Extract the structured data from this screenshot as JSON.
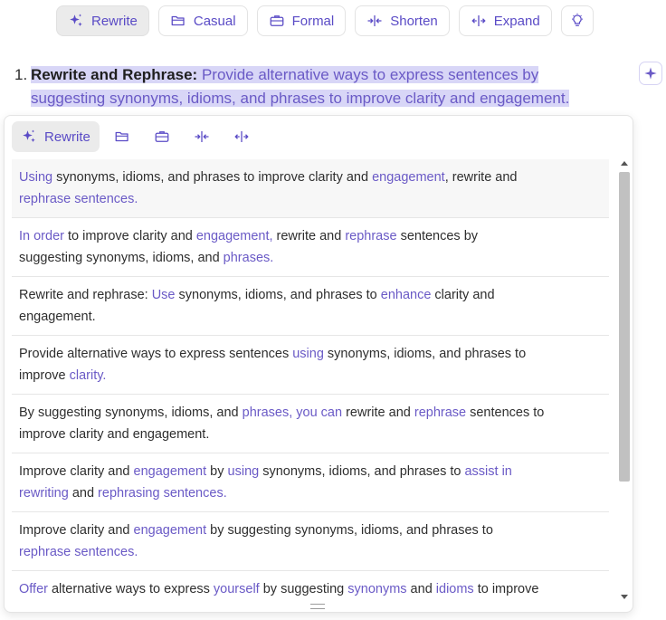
{
  "toolbar": {
    "buttons": [
      {
        "label": "Rewrite",
        "icon": "sparkle-icon",
        "active": true
      },
      {
        "label": "Casual",
        "icon": "folder-icon"
      },
      {
        "label": "Formal",
        "icon": "briefcase-icon"
      },
      {
        "label": "Shorten",
        "icon": "shorten-icon"
      },
      {
        "label": "Expand",
        "icon": "expand-icon"
      }
    ],
    "extra_icon": "lightbulb-icon"
  },
  "editor": {
    "list_number": "1.",
    "bold_text": "Rewrite and Rephrase:",
    "text_line1": " Provide alternative ways to express sentences by",
    "text_line2": "suggesting synonyms, idioms, and phrases to improve clarity and engagement."
  },
  "panel": {
    "active_label": "Rewrite",
    "suggestions": [
      [
        {
          "t": "Using",
          "h": true
        },
        {
          "t": " synonyms, idioms, and phrases to improve clarity and "
        },
        {
          "t": "engagement",
          "h": true
        },
        {
          "t": ", rewrite and "
        },
        {
          "br": true
        },
        {
          "t": "rephrase sentences.",
          "h": true
        }
      ],
      [
        {
          "t": "In order",
          "h": true
        },
        {
          "t": " to improve clarity and "
        },
        {
          "t": "engagement,",
          "h": true
        },
        {
          "t": " rewrite and "
        },
        {
          "t": "rephrase",
          "h": true
        },
        {
          "t": " sentences by "
        },
        {
          "br": true
        },
        {
          "t": "suggesting synonyms, idioms, and "
        },
        {
          "t": "phrases.",
          "h": true
        }
      ],
      [
        {
          "t": "Rewrite and rephrase: "
        },
        {
          "t": "Use",
          "h": true
        },
        {
          "t": " synonyms, idioms, and phrases to "
        },
        {
          "t": "enhance",
          "h": true
        },
        {
          "t": " clarity and "
        },
        {
          "br": true
        },
        {
          "t": "engagement."
        }
      ],
      [
        {
          "t": "Provide alternative ways to express sentences "
        },
        {
          "t": "using",
          "h": true
        },
        {
          "t": " synonyms, idioms, and phrases to "
        },
        {
          "br": true
        },
        {
          "t": "improve "
        },
        {
          "t": "clarity.",
          "h": true
        }
      ],
      [
        {
          "t": "By suggesting synonyms, idioms, and "
        },
        {
          "t": "phrases, you can",
          "h": true
        },
        {
          "t": " rewrite and "
        },
        {
          "t": "rephrase",
          "h": true
        },
        {
          "t": " sentences to "
        },
        {
          "br": true
        },
        {
          "t": "improve clarity and engagement."
        }
      ],
      [
        {
          "t": "Improve clarity and "
        },
        {
          "t": "engagement",
          "h": true
        },
        {
          "t": " by "
        },
        {
          "t": "using",
          "h": true
        },
        {
          "t": " synonyms, idioms, and phrases to "
        },
        {
          "t": "assist in",
          "h": true
        },
        {
          "br": true
        },
        {
          "t": "rewriting",
          "h": true
        },
        {
          "t": " and "
        },
        {
          "t": "rephrasing sentences.",
          "h": true
        }
      ],
      [
        {
          "t": "Improve clarity and "
        },
        {
          "t": "engagement",
          "h": true
        },
        {
          "t": " by suggesting synonyms, idioms, and phrases to "
        },
        {
          "br": true
        },
        {
          "t": "rephrase sentences.",
          "h": true
        }
      ],
      [
        {
          "t": "Offer",
          "h": true
        },
        {
          "t": " alternative ways to express "
        },
        {
          "t": "yourself",
          "h": true
        },
        {
          "t": " by suggesting "
        },
        {
          "t": "synonyms",
          "h": true
        },
        {
          "t": " and "
        },
        {
          "t": "idioms",
          "h": true
        },
        {
          "t": " to improve"
        }
      ]
    ]
  },
  "colors": {
    "accent": "#5a4bc6",
    "highlight": "#d8d6f7"
  }
}
